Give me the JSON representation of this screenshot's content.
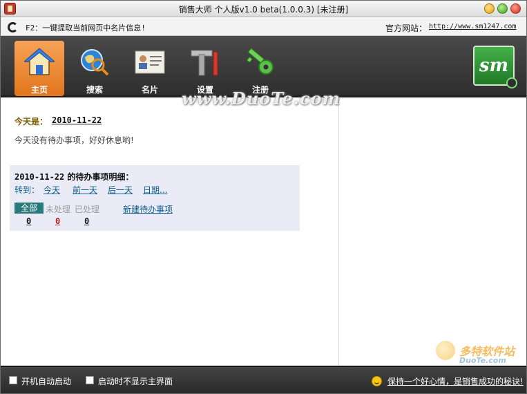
{
  "window": {
    "title": "销售大师 个人版v1.0 beta(1.0.0.3) [未注册]"
  },
  "hint_bar": {
    "hint": "F2：一键提取当前网页中名片信息!",
    "site_label": "官方网站：",
    "site_url": "http://www.sm1247.com"
  },
  "toolbar": {
    "items": [
      {
        "label": "主页",
        "icon": "house-icon",
        "active": true
      },
      {
        "label": "搜索",
        "icon": "globe-search-icon",
        "active": false
      },
      {
        "label": "名片",
        "icon": "business-card-icon",
        "active": false
      },
      {
        "label": "设置",
        "icon": "tools-icon",
        "active": false
      },
      {
        "label": "注册",
        "icon": "key-icon",
        "active": false
      }
    ],
    "logo": "sm"
  },
  "today": {
    "label": "今天是：",
    "date": "2010-11-22",
    "message": "今天没有待办事项，好好休息哟!"
  },
  "todo_panel": {
    "date": "2010-11-22",
    "title_suffix": " 的待办事项明细：",
    "goto_label": "转到：",
    "nav": {
      "today": "今天",
      "prev": "前一天",
      "next": "后一天",
      "date": "日期..."
    },
    "filters": {
      "all": "全部",
      "pending": "未处理",
      "done": "已处理"
    },
    "counts": {
      "all": "0",
      "pending": "0",
      "done": "0"
    },
    "new_todo": "新建待办事项"
  },
  "watermark": {
    "text": "www.DuoTe.com",
    "corner_line1": "多特软件站",
    "corner_line2": "DuoTe.com"
  },
  "status_bar": {
    "autostart": "开机自动启动",
    "hide_on_start": "启动时不显示主界面",
    "motto": "保持一个好心情，是销售成功的秘诀!"
  },
  "colors": {
    "toolbar_bg": "#3a3a3a",
    "active_tab": "#e98a2c",
    "link": "#0b5e8a",
    "panel_bg": "#ebebf7",
    "filter_active": "#277b7d",
    "pending_count": "#b0201a"
  }
}
